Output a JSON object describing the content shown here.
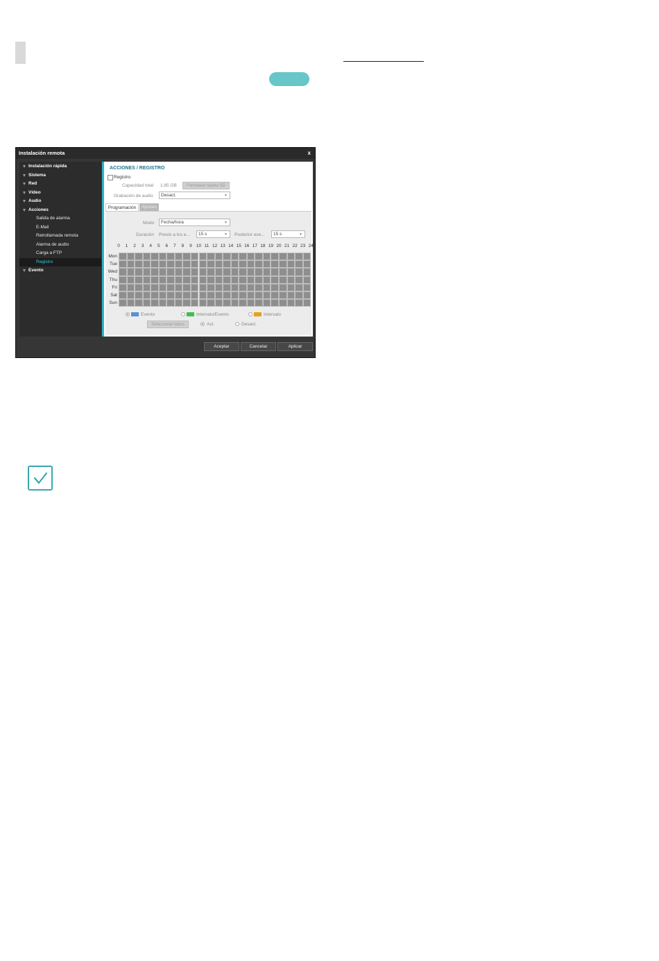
{
  "page": {
    "note_icon": "checkmark-icon"
  },
  "dialog": {
    "title": "Instalación remota",
    "close": "x",
    "sidebar": [
      {
        "label": "Instalación rápida",
        "level": "top"
      },
      {
        "label": "Sistema",
        "level": "top"
      },
      {
        "label": "Red",
        "level": "top"
      },
      {
        "label": "Vídeo",
        "level": "top"
      },
      {
        "label": "Audio",
        "level": "top"
      },
      {
        "label": "Acciones",
        "level": "top"
      },
      {
        "label": "Salida de alarma",
        "level": "sub"
      },
      {
        "label": "E-Mail",
        "level": "sub"
      },
      {
        "label": "Retrollamada remota",
        "level": "sub"
      },
      {
        "label": "Alarma de audio",
        "level": "sub"
      },
      {
        "label": "Carga a FTP",
        "level": "sub"
      },
      {
        "label": "Registro",
        "level": "sub",
        "selected": true
      },
      {
        "label": "Evento",
        "level": "top"
      }
    ],
    "content": {
      "title": "ACCIONES / REGISTRO",
      "registro_label": "Registro",
      "capacidad_label": "Capacidad total",
      "capacidad_value": "1.85 GB",
      "format_button": "Formatear tarjeta SD",
      "audio_label": "Grabación de audio",
      "audio_value": "Desact.",
      "tabs": [
        "Programación",
        "Ajustes"
      ],
      "modo_label": "Modo",
      "modo_value": "Fecha/hora",
      "duracion_label": "Duración",
      "previo_label": "Previo a los e...",
      "previo_value": "15 s",
      "posterior_label": "Posterior eve...",
      "posterior_value": "15 s",
      "hours": [
        "0",
        "1",
        "2",
        "3",
        "4",
        "5",
        "6",
        "7",
        "8",
        "9",
        "10",
        "11",
        "12",
        "13",
        "14",
        "15",
        "16",
        "17",
        "18",
        "19",
        "20",
        "21",
        "22",
        "23",
        "24"
      ],
      "days": [
        "Mon",
        "Tue",
        "Wed",
        "Thu",
        "Fri",
        "Sat",
        "Sun"
      ],
      "legend": [
        {
          "label": "Evento",
          "color": "#5b8fd6",
          "selected": true
        },
        {
          "label": "Intervalo/Evento",
          "color": "#3fc04d",
          "selected": false
        },
        {
          "label": "Intervalo",
          "color": "#e8a019",
          "selected": false
        }
      ],
      "select_all_button": "Seleccionar todos",
      "act_label": "Act.",
      "desact_label": "Desact."
    },
    "buttons": {
      "aceptar": "Aceptar",
      "cancelar": "Cancelar",
      "aplicar": "Aplicar"
    }
  }
}
